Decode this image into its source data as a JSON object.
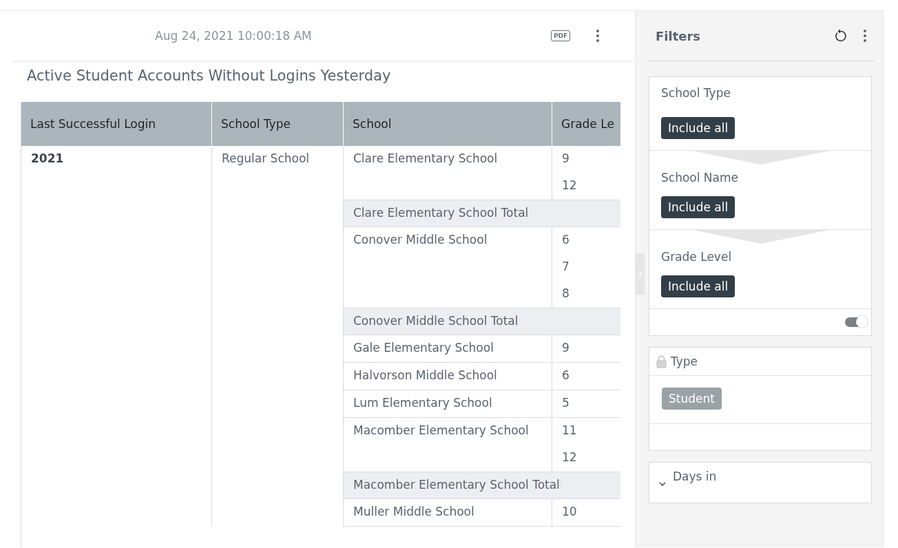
{
  "header": {
    "timestamp": "Aug 24, 2021 10:00:18 AM",
    "export_label": "PDF"
  },
  "report": {
    "title": "Active Student Accounts Without Logins Yesterday",
    "columns": [
      "Last Successful Login",
      "School Type",
      "School",
      "Grade Le"
    ],
    "year": "2021",
    "school_type": "Regular School",
    "schools": [
      {
        "name": "Clare Elementary School",
        "grades": [
          "9",
          "12"
        ],
        "total": "Clare Elementary School Total"
      },
      {
        "name": "Conover Middle School",
        "grades": [
          "6",
          "7",
          "8"
        ],
        "total": "Conover Middle School Total"
      },
      {
        "name": "Gale Elementary School",
        "grades": [
          "9"
        ]
      },
      {
        "name": "Halvorson Middle School",
        "grades": [
          "6"
        ]
      },
      {
        "name": "Lum Elementary School",
        "grades": [
          "5"
        ]
      },
      {
        "name": "Macomber Elementary School",
        "grades": [
          "11",
          "12"
        ],
        "total": "Macomber Elementary School Total"
      },
      {
        "name": "Muller Middle School",
        "grades": [
          "10"
        ]
      }
    ]
  },
  "filters": {
    "title": "Filters",
    "cascade": [
      {
        "label": "School Type",
        "chip": "Include all"
      },
      {
        "label": "School Name",
        "chip": "Include all"
      },
      {
        "label": "Grade Level",
        "chip": "Include all"
      }
    ],
    "cascade_toggle_on": true,
    "type_filter": {
      "label": "Type",
      "locked": true,
      "chip": "Student"
    },
    "days_filter": {
      "label": "Days in",
      "expanded": false
    }
  }
}
